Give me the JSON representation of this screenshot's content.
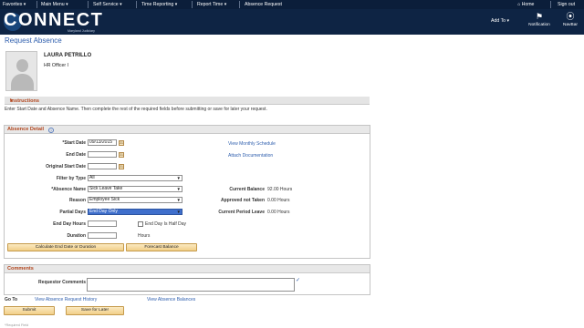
{
  "topnav": {
    "favorites": "Favorites",
    "main_menu": "Main Menu",
    "self_service": "Self Service",
    "time_reporting": "Time Reporting",
    "report_time": "Report Time",
    "absence_request": "Absence Request",
    "home": "Home",
    "sign_out": "Sign out",
    "chevron": "▾",
    "sep": "›"
  },
  "banner": {
    "logo_text": "CONNECT",
    "logo_sub": "Maryland Judiciary",
    "add_to": "Add To",
    "notification": "Notification",
    "navbar": "NavBar"
  },
  "page": {
    "title": "Request Absence"
  },
  "employee": {
    "name": "LAURA PETRILLO",
    "job_title": "HR Officer I"
  },
  "instructions": {
    "heading": "Instructions",
    "text": "Enter Start Date and Absence Name. Then complete the rest of the required fields before submitting or save for later your request."
  },
  "absence_detail": {
    "heading": "Absence Detail",
    "help": "?",
    "start_date_label": "*Start Date",
    "start_date_value": "09/13/2015",
    "end_date_label": "End Date",
    "end_date_value": "",
    "original_start_label": "Original Start Date",
    "original_start_value": "",
    "filter_label": "Filter by Type",
    "filter_value": "All",
    "absence_name_label": "*Absence Name",
    "absence_name_value": "Sick Leave Take",
    "reason_label": "Reason",
    "reason_value": "Employee Sick",
    "partial_days_label": "Partial Days",
    "partial_days_value": "End Day Only",
    "end_day_hours_label": "End Day Hours",
    "end_day_hours_value": "",
    "half_day_label": "End Day Is Half Day",
    "duration_label": "Duration",
    "duration_value": "",
    "hours_unit": "Hours",
    "calc_button": "Calculate End Date or Duration",
    "forecast_button": "Forecast Balance",
    "view_schedule": "View Monthly Schedule",
    "attach_doc": "Attach Documentation",
    "current_balance_label": "Current Balance",
    "current_balance_value": "92.00 Hours",
    "approved_label": "Approved not Taken",
    "approved_value": "0.00 Hours",
    "current_period_label": "Current Period Leave",
    "current_period_value": "0.00 Hours"
  },
  "comments": {
    "heading": "Comments",
    "requestor_label": "Requestor Comments",
    "requestor_value": ""
  },
  "goto": {
    "label": "Go To",
    "history": "View Absence Request History",
    "balances": "View Absence Balances"
  },
  "actions": {
    "submit": "Submit",
    "save": "Save for Later"
  },
  "footer": {
    "text": "*Required Field"
  },
  "icons": {
    "home": "home-icon",
    "notification": "flag-icon",
    "navbar": "compass-icon",
    "calendar": "calendar-icon",
    "spell": "spell-check-icon"
  },
  "colors": {
    "nav_bg": "#0b1e3a",
    "banner_bg": "#0e2444",
    "link": "#2f5fae",
    "section_heading": "#b2461e",
    "button": "#f1cf88"
  }
}
